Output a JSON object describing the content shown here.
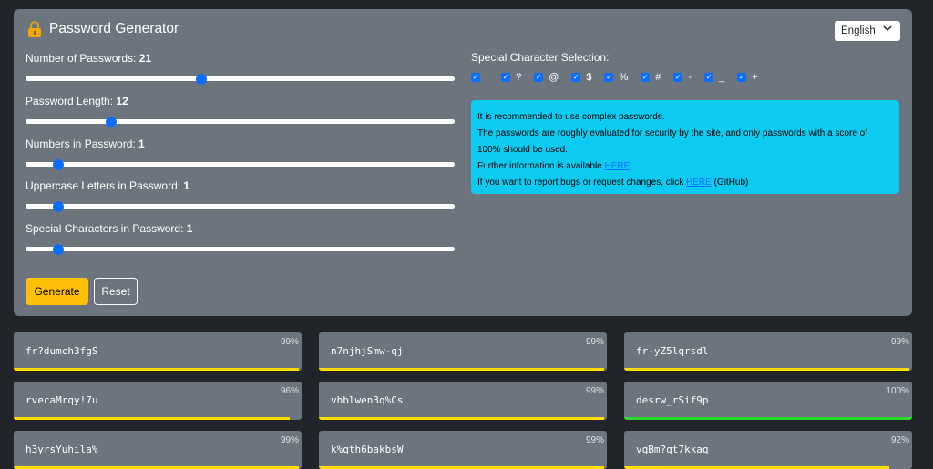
{
  "header": {
    "title": "Password Generator",
    "language": "English"
  },
  "sliders": [
    {
      "label": "Number of Passwords: ",
      "value": "21",
      "fraction": 0.41
    },
    {
      "label": "Password Length: ",
      "value": "12",
      "fraction": 0.2
    },
    {
      "label": "Numbers in Password: ",
      "value": "1",
      "fraction": 0.077
    },
    {
      "label": "Uppercase Letters in Password: ",
      "value": "1",
      "fraction": 0.077
    },
    {
      "label": "Special Characters in Password: ",
      "value": "1",
      "fraction": 0.077
    }
  ],
  "buttons": {
    "generate": "Generate",
    "reset": "Reset"
  },
  "special": {
    "title": "Special Character Selection:",
    "chars": [
      "!",
      "?",
      "@",
      "$",
      "%",
      "#",
      "-",
      "_",
      "+"
    ]
  },
  "info": {
    "line1": "It is recommended to use complex passwords.",
    "line2": "The passwords are roughly evaluated for security by the site, and only passwords with a score of 100% should be used.",
    "line3_pre": "Further information is available ",
    "line3_link": "HERE",
    "line3_post": ".",
    "line4_pre": "If you want to report bugs or request changes, click ",
    "line4_link": "HERE",
    "line4_post": " (GitHub)"
  },
  "passwords": [
    {
      "text": "fr?dumch3fgS",
      "score": "99%",
      "fill": 0.99,
      "color": "#ffdd00"
    },
    {
      "text": "n7njhjSmw-qj",
      "score": "99%",
      "fill": 0.99,
      "color": "#ffdd00"
    },
    {
      "text": "fr-yZ5lqrsdl",
      "score": "99%",
      "fill": 0.99,
      "color": "#ffdd00"
    },
    {
      "text": "rvecaMrqy!7u",
      "score": "96%",
      "fill": 0.96,
      "color": "#ffdd00"
    },
    {
      "text": "vhblwen3q%Cs",
      "score": "99%",
      "fill": 0.99,
      "color": "#ffdd00"
    },
    {
      "text": "desrw_rSif9p",
      "score": "100%",
      "fill": 1.0,
      "color": "#2bd92b"
    },
    {
      "text": "h3yrsYuhila%",
      "score": "99%",
      "fill": 0.99,
      "color": "#ffdd00"
    },
    {
      "text": "k%qth6bakbsW",
      "score": "99%",
      "fill": 0.99,
      "color": "#ffdd00"
    },
    {
      "text": "vqBm?qt7kkaq",
      "score": "92%",
      "fill": 0.92,
      "color": "#ffdd00"
    }
  ]
}
